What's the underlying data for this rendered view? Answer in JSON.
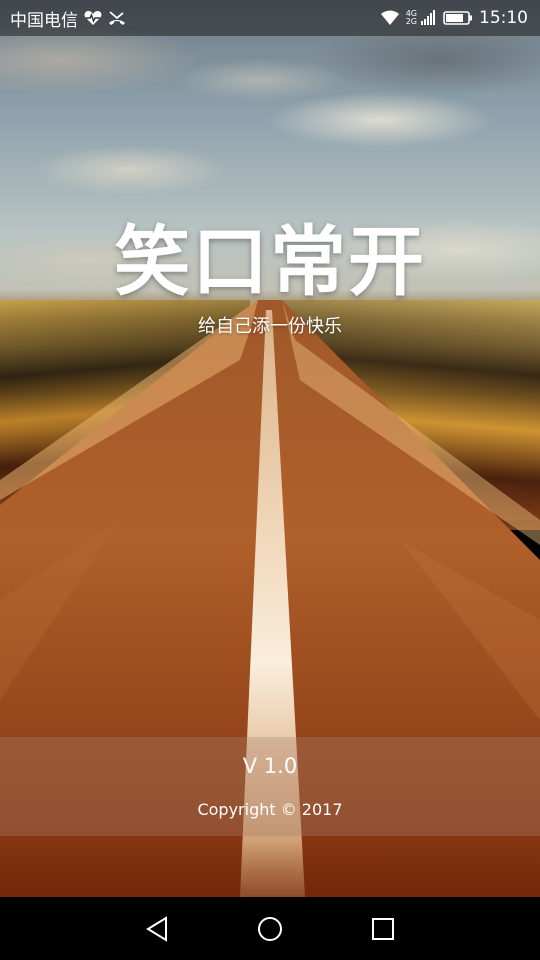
{
  "status_bar": {
    "carrier": "中国电信",
    "network_top": "4G",
    "network_bottom": "2G",
    "time": "15:10",
    "icons": [
      "heart-monitor-icon",
      "missed-call-icon",
      "wifi-icon",
      "signal-icon",
      "battery-icon"
    ]
  },
  "splash": {
    "title": "笑口常开",
    "subtitle": "给自己添一份快乐",
    "version": "V 1.0",
    "copyright": "Copyright © 2017"
  },
  "nav_bar": {
    "buttons": [
      "back-icon",
      "home-icon",
      "recents-icon"
    ]
  },
  "colors": {
    "status_bar_bg": "#1e1e1e",
    "nav_bar_bg": "#000000",
    "road": "#8a3a12",
    "text": "#ffffff"
  }
}
